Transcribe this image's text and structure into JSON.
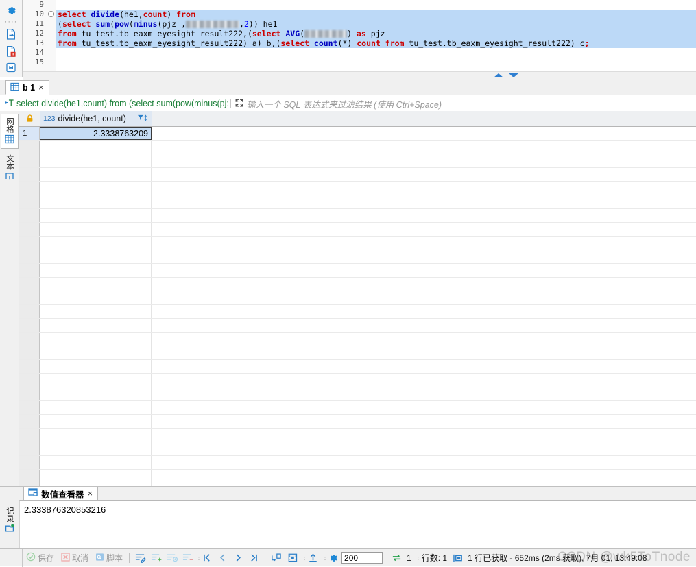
{
  "editor": {
    "line_numbers": [
      "9",
      "10",
      "11",
      "12",
      "13",
      "14",
      "15"
    ],
    "lines": [
      {
        "n": "9",
        "selected": false,
        "tokens": []
      },
      {
        "n": "10",
        "selected": true,
        "fold": true,
        "tokens": [
          {
            "t": "kw",
            "v": "select "
          },
          {
            "t": "fn",
            "v": "divide"
          },
          {
            "t": "pl",
            "v": "(he1,"
          },
          {
            "t": "kw",
            "v": "count"
          },
          {
            "t": "pl",
            "v": ") "
          },
          {
            "t": "kw",
            "v": "from"
          }
        ]
      },
      {
        "n": "11",
        "selected": true,
        "tokens": [
          {
            "t": "pl",
            "v": "("
          },
          {
            "t": "kw",
            "v": "select "
          },
          {
            "t": "fn",
            "v": "sum"
          },
          {
            "t": "pl",
            "v": "("
          },
          {
            "t": "fn",
            "v": "pow"
          },
          {
            "t": "pl",
            "v": "("
          },
          {
            "t": "fn",
            "v": "minus"
          },
          {
            "t": "pl",
            "v": "(pjz ,"
          },
          {
            "t": "redact",
            "v": "",
            "w": 78
          },
          {
            "t": "pl",
            "v": ","
          },
          {
            "t": "num",
            "v": "2"
          },
          {
            "t": "pl",
            "v": ")) he1"
          }
        ]
      },
      {
        "n": "12",
        "selected": true,
        "tokens": [
          {
            "t": "kw",
            "v": "from "
          },
          {
            "t": "pl",
            "v": "tu_test.tb_eaxm_eyesight_result222,("
          },
          {
            "t": "kw",
            "v": "select "
          },
          {
            "t": "fn",
            "v": "AVG"
          },
          {
            "t": "pl",
            "v": "("
          },
          {
            "t": "redact",
            "v": "",
            "w": 62
          },
          {
            "t": "pl",
            "v": ") "
          },
          {
            "t": "kw",
            "v": "as"
          },
          {
            "t": "pl",
            "v": " pjz"
          }
        ]
      },
      {
        "n": "13",
        "selected": true,
        "tokens": [
          {
            "t": "kw",
            "v": "from "
          },
          {
            "t": "pl",
            "v": "tu_test.tb_eaxm_eyesight_result222) a) b,("
          },
          {
            "t": "kw",
            "v": "select "
          },
          {
            "t": "fn",
            "v": "count"
          },
          {
            "t": "pl",
            "v": "(*) "
          },
          {
            "t": "kw",
            "v": "count "
          },
          {
            "t": "kw",
            "v": "from "
          },
          {
            "t": "pl",
            "v": "tu_test.tb_eaxm_eyesight_result222) c"
          },
          {
            "t": "semi",
            "v": ";"
          }
        ]
      },
      {
        "n": "14",
        "selected": false,
        "tokens": []
      },
      {
        "n": "15",
        "selected": false,
        "tokens": []
      }
    ],
    "rail_icons": [
      "gear-icon",
      "dots-icon",
      "export-script-icon",
      "error-file-icon",
      "execute-file-icon"
    ],
    "scroll_up_label": "scroll-up",
    "scroll_down_label": "scroll-down"
  },
  "results": {
    "tab": {
      "label": "b 1",
      "icon": "grid-icon",
      "close": "×"
    },
    "filter": {
      "prefix_icon": "filter-text-icon",
      "sql": "select divide(he1,count) from (select sum(pow(minus(pj:",
      "expand_icon": "expand-icon",
      "placeholder": "输入一个 SQL 表达式来过滤结果 (使用 Ctrl+Space)"
    },
    "side_tabs": [
      {
        "label": "网格",
        "icon": "grid-view-icon",
        "active": true
      },
      {
        "label": "文本",
        "icon": "text-view-icon",
        "active": false
      }
    ],
    "grid": {
      "lock_icon": "lock-icon",
      "columns": [
        {
          "type_badge": "123",
          "name": "divide(he1, count)",
          "filter_sort_icon": "filter-sort-icon"
        }
      ],
      "rows": [
        {
          "num": "1",
          "values": [
            "2.3338763209"
          ]
        }
      ],
      "empty_row_count": 26
    }
  },
  "value_viewer": {
    "tab": {
      "label": "数值查看器",
      "icon": "value-viewer-icon",
      "close": "×"
    },
    "side_tab": {
      "label": "记录",
      "icon": "record-icon"
    },
    "value": "2.333876320853216"
  },
  "statusbar": {
    "save_label": "保存",
    "save_icon": "check-circle-icon",
    "cancel_label": "取消",
    "cancel_icon": "cancel-icon",
    "script_label": "脚本",
    "script_icon": "script-icon",
    "edit_icons": [
      "edit-row-icon",
      "add-row-icon",
      "duplicate-row-icon",
      "delete-row-icon"
    ],
    "nav_icons": [
      "first-page-icon",
      "prev-page-icon",
      "next-page-icon",
      "last-page-icon"
    ],
    "misc_icons": [
      "fetch-next-icon",
      "fetch-all-icon",
      "export-icon",
      "settings-gear-icon"
    ],
    "fetch_size": "200",
    "refresh_icon": "refresh-icon",
    "refresh_count": "1",
    "rows_label": "行数: 1",
    "result_icon": "result-icon",
    "result_text": "1 行已获取 - 652ms (2ms 获取), 7月 01, 13:49:08"
  },
  "watermark": {
    "text": "CSDN @wk5ToTnode"
  },
  "colors": {
    "accent": "#2a6fb5",
    "keyword": "#cc0000",
    "function": "#0000c0",
    "selection": "#bcd9f7",
    "filter_sql": "#1a7f37",
    "cell_selected": "#c5dcf5"
  }
}
